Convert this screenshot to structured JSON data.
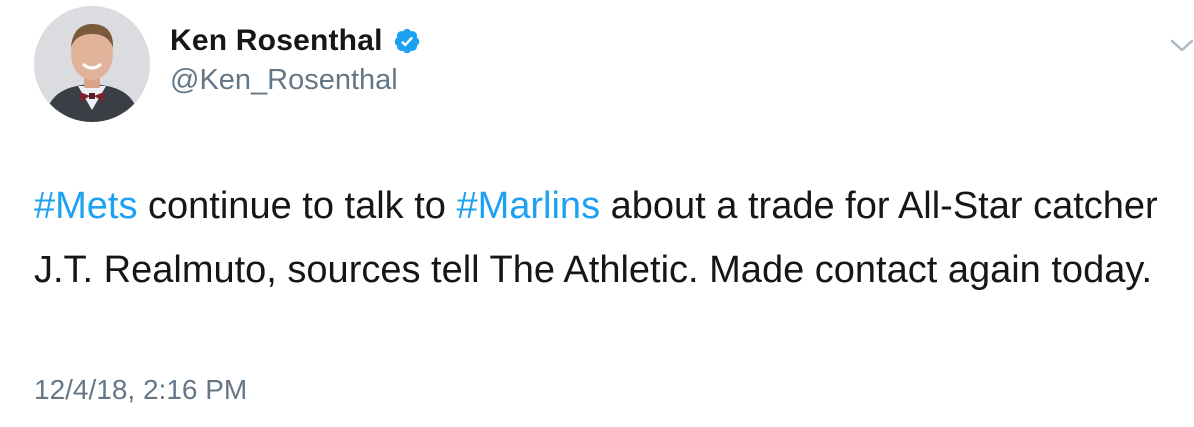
{
  "author": {
    "display_name": "Ken Rosenthal",
    "handle": "@Ken_Rosenthal",
    "verified": true
  },
  "tweet": {
    "hashtag_1": "#Mets",
    "text_1": " continue to talk to ",
    "hashtag_2": "#Marlins",
    "text_2": " about a trade for All-Star catcher J.T. Realmuto, sources tell The Athletic. Made contact again today."
  },
  "timestamp": "12/4/18, 2:16 PM",
  "colors": {
    "link": "#1da1f2",
    "text": "#14171a",
    "secondary": "#657786"
  },
  "icons": {
    "verified": "verified-badge-icon",
    "menu": "chevron-down-icon"
  }
}
